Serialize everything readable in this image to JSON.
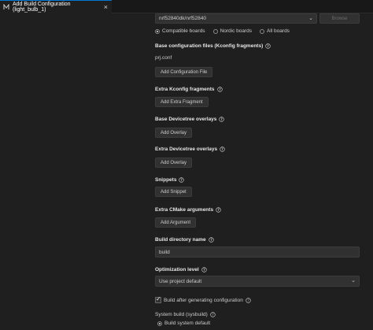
{
  "tab": {
    "title": "Add Build Configuration (light_bulb_1)",
    "close": "×"
  },
  "board": {
    "selected": "nrf52840dk/nrf52840",
    "browse_label": "Browse",
    "filters": [
      {
        "label": "Compatible boards",
        "selected": true
      },
      {
        "label": "Nordic boards",
        "selected": false
      },
      {
        "label": "All boards",
        "selected": false
      }
    ]
  },
  "base_conf": {
    "title": "Base configuration files (Kconfig fragments)",
    "file": "prj.conf",
    "button": "Add Configuration File"
  },
  "extra_kconfig": {
    "title": "Extra Kconfig fragments",
    "button": "Add Extra Fragment"
  },
  "base_overlays": {
    "title": "Base Devicetree overlays",
    "button": "Add Overlay"
  },
  "extra_overlays": {
    "title": "Extra Devicetree overlays",
    "button": "Add Overlay"
  },
  "snippets": {
    "title": "Snippets",
    "button": "Add Snippet"
  },
  "cmake": {
    "title": "Extra CMake arguments",
    "button": "Add Argument"
  },
  "build_dir": {
    "title": "Build directory name",
    "value": "build"
  },
  "optimization": {
    "title": "Optimization level",
    "selected": "Use project default"
  },
  "build_after": {
    "label": "Build after generating configuration",
    "checked": true
  },
  "sysbuild": {
    "title": "System build (sysbuild)",
    "option": "Build system default"
  },
  "colors": {
    "background": "#1f1f1f",
    "accent": "#0078d4",
    "control": "#313131"
  }
}
